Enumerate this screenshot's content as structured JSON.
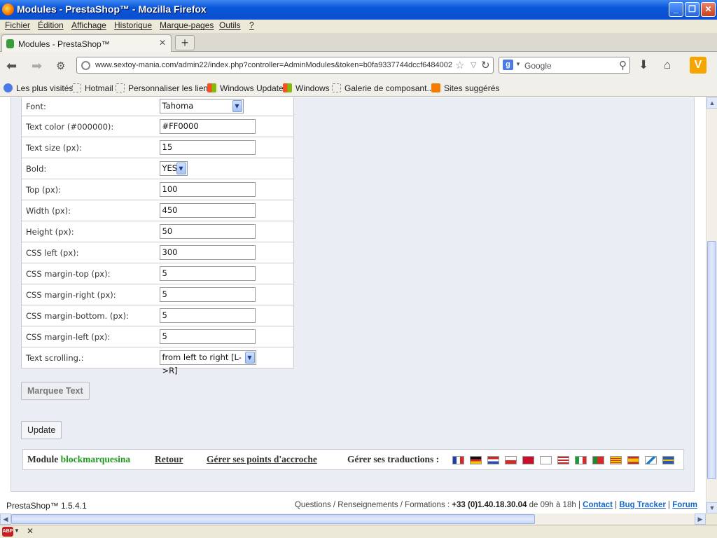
{
  "window": {
    "title": "Modules - PrestaShop™ - Mozilla Firefox"
  },
  "menu": [
    "Fichier",
    "Édition",
    "Affichage",
    "Historique",
    "Marque-pages",
    "Outils",
    "?"
  ],
  "tab": {
    "label": "Modules - PrestaShop™"
  },
  "address": {
    "url": "www.sextoy-mania.com/admin22/index.php?controller=AdminModules&token=b0fa9337744dccf6484002"
  },
  "search": {
    "placeholder": "Google",
    "engine_letter": "g"
  },
  "bookmarks": [
    "Les plus visités",
    "Hotmail",
    "Personnaliser les liens",
    "Windows Update",
    "Windows",
    "Galerie de composant...",
    "Sites suggérés"
  ],
  "form": [
    {
      "label": "Font:",
      "value": "Tahoma",
      "type": "select"
    },
    {
      "label": "Text color (#000000):",
      "value": "#FF0000",
      "type": "input"
    },
    {
      "label": "Text size (px):",
      "value": "15",
      "type": "input"
    },
    {
      "label": "Bold:",
      "value": "YES",
      "type": "select"
    },
    {
      "label": "Top (px):",
      "value": "100",
      "type": "input"
    },
    {
      "label": "Width (px):",
      "value": "450",
      "type": "input"
    },
    {
      "label": "Height (px):",
      "value": "50",
      "type": "input"
    },
    {
      "label": "CSS left (px):",
      "value": "300",
      "type": "input"
    },
    {
      "label": "CSS margin-top (px):",
      "value": "5",
      "type": "input"
    },
    {
      "label": "CSS margin-right (px):",
      "value": "5",
      "type": "input"
    },
    {
      "label": "CSS margin-bottom. (px):",
      "value": "5",
      "type": "input"
    },
    {
      "label": "CSS margin-left (px):",
      "value": "5",
      "type": "input"
    },
    {
      "label": "Text scrolling.:",
      "value": "from left to right [L->R]",
      "type": "select"
    }
  ],
  "marquee_label": "Marquee Text",
  "update_label": "Update",
  "footer": {
    "module_prefix": "Module",
    "module_name": "blockmarquesina",
    "back": "Retour",
    "hooks": "Gérer ses points d'accroche",
    "translations": "Gérer ses traductions :"
  },
  "flags": [
    "fr",
    "de",
    "nl",
    "cz",
    "dk",
    "fi",
    "us",
    "it",
    "pt",
    "ca",
    "es",
    "other",
    "se"
  ],
  "status": {
    "version": "PrestaShop™ 1.5.4.1",
    "info_text": "Questions / Renseignements / Formations : ",
    "phone": "+33 (0)1.40.18.30.04",
    "hours": " de 09h à 18h | ",
    "contact": "Contact",
    "bugtracker": "Bug Tracker",
    "forum": "Forum"
  }
}
